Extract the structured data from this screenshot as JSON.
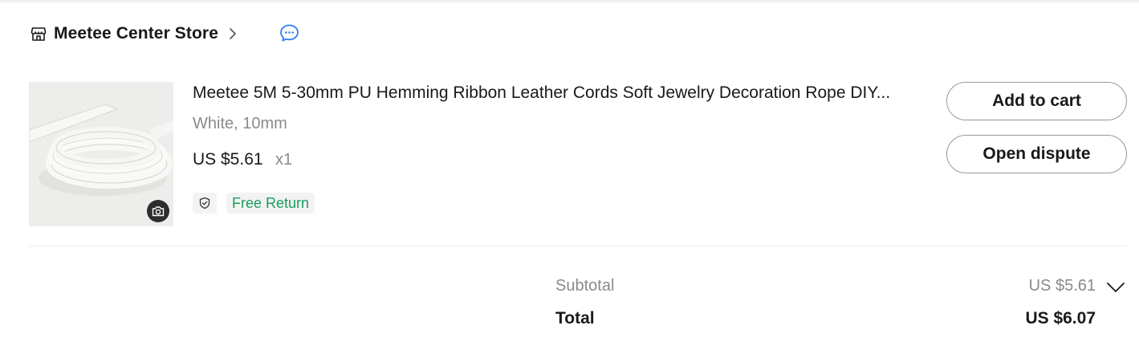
{
  "store": {
    "name": "Meetee Center Store",
    "icon": "store-icon",
    "chat_icon": "chat-bubble-icon"
  },
  "item": {
    "title": "Meetee 5M 5-30mm PU Hemming Ribbon Leather Cords Soft Jewelry Decoration Rope DIY...",
    "variant": "White, 10mm",
    "price": "US $5.61",
    "quantity": "x1",
    "badge": "Free Return",
    "badge_color": "#1a9e5c",
    "image_icon": "camera-icon"
  },
  "actions": {
    "add_to_cart": "Add to cart",
    "open_dispute": "Open dispute"
  },
  "summary": {
    "subtotal_label": "Subtotal",
    "subtotal_value": "US $5.61",
    "total_label": "Total",
    "total_value": "US $6.07"
  }
}
